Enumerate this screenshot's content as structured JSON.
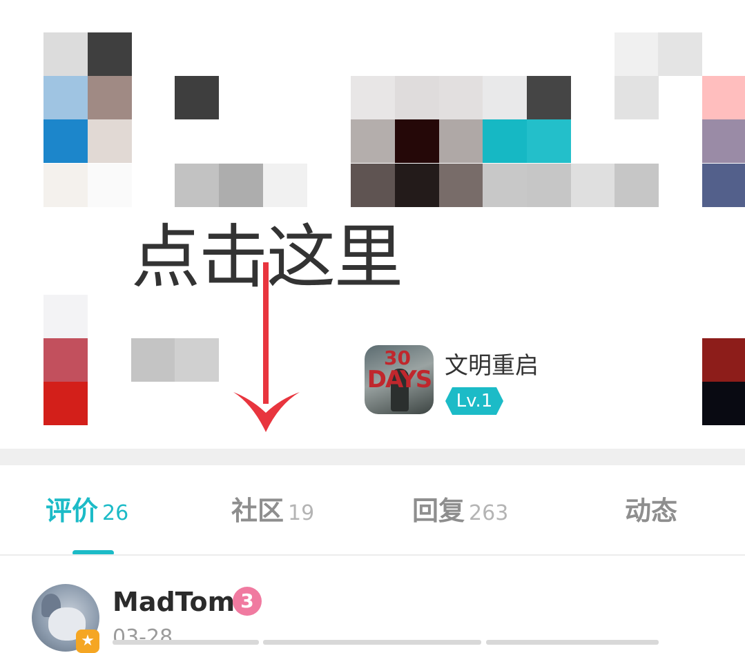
{
  "annotation": {
    "text": "点击这里"
  },
  "game": {
    "name": "文明重启",
    "level": "Lv.1",
    "icon_text_top": "30",
    "icon_text_main": "DAYS"
  },
  "tabs": [
    {
      "label": "评价",
      "count": "26",
      "active": true
    },
    {
      "label": "社区",
      "count": "19",
      "active": false
    },
    {
      "label": "回复",
      "count": "263",
      "active": false
    },
    {
      "label": "动态",
      "count": "",
      "active": false
    }
  ],
  "review": {
    "username": "MadTom",
    "date": "03-28",
    "badge_glyph": "3",
    "avatar_badge_glyph": "★"
  },
  "colors": {
    "accent": "#1cbbc7",
    "arrow": "#e8353e",
    "badge_pink": "#f07aa0",
    "tab_inactive": "#8e8e8e"
  },
  "mosaic": [
    "#dcdcdc",
    "#3f3f3f",
    "#f0f0f0",
    "#f3f3f3",
    "#e8e8e8",
    "#d9d9d9",
    "#9fc4e2",
    "#a08a84",
    "#3e3e3e",
    "#e8e6e6",
    "#dfdcdc",
    "#e2dfdf",
    "#e9e9ea",
    "#454545",
    "#e2e2e2",
    "#ffbebe",
    "#1c86cb",
    "#e1d9d4",
    "#b4aeac",
    "#250808",
    "#afa8a6",
    "#16b8c4",
    "#23bfca",
    "#9a8ba6",
    "#f4f1ed",
    "#fafafa",
    "#c2c2c2",
    "#adadad",
    "#f1f1f1",
    "#5f5452",
    "#231b1a",
    "#786c69",
    "#c8c8c8",
    "#c6c6c6",
    "#dfdfdf",
    "#c6c6c6",
    "#53608b",
    "#f3f3f5",
    "#c2505d",
    "#c4c4c4",
    "#d0d0d0",
    "#8d1d1a",
    "#d31f1a",
    "#090a12"
  ]
}
